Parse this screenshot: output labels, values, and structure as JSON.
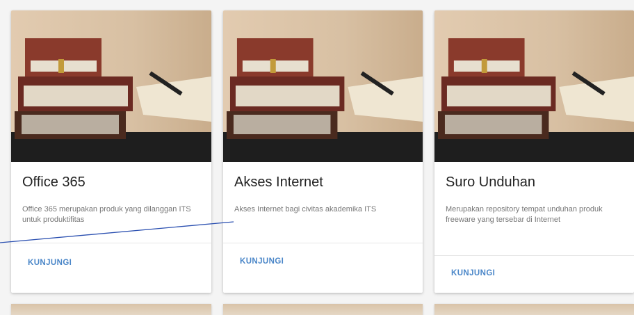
{
  "cards": [
    {
      "title": "Office 365",
      "description": "Office 365 merupakan produk yang dilanggan ITS untuk produktifitas",
      "action_label": "KUNJUNGI"
    },
    {
      "title": "Akses Internet",
      "description": "Akses Internet bagi civitas akademika ITS",
      "action_label": "KUNJUNGI"
    },
    {
      "title": "Suro Unduhan",
      "description": "Merupakan repository tempat unduhan produk freeware yang tersebar di Internet",
      "action_label": "KUNJUNGI"
    }
  ],
  "colors": {
    "action_text": "#4a86c8",
    "annotation_line": "#2a4fb0"
  },
  "icons": {
    "card_image": "books-photo-icon"
  }
}
